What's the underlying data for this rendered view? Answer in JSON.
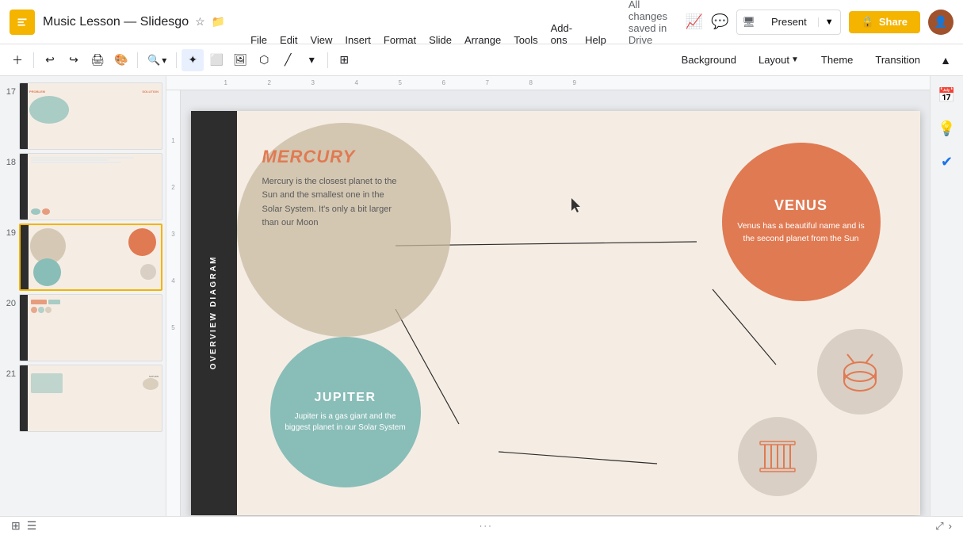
{
  "app": {
    "title": "Music Lesson — Slidesgo",
    "icon_color": "#f4b400"
  },
  "menu": {
    "file": "File",
    "edit": "Edit",
    "view": "View",
    "insert": "Insert",
    "format": "Format",
    "slide": "Slide",
    "arrange": "Arrange",
    "tools": "Tools",
    "addons": "Add-ons",
    "help": "Help",
    "autosave": "All changes saved in Drive"
  },
  "toolbar2": {
    "background": "Background",
    "layout": "Layout",
    "theme": "Theme",
    "transition": "Transition"
  },
  "slides": [
    {
      "num": "17",
      "active": false
    },
    {
      "num": "18",
      "active": false
    },
    {
      "num": "19",
      "active": true
    },
    {
      "num": "20",
      "active": false
    },
    {
      "num": "21",
      "active": false
    }
  ],
  "slide_content": {
    "sidebar_label": "OVERVIEW DIAGRAM",
    "mercury": {
      "title": "MERCURY",
      "body": "Mercury is the closest planet to the Sun and the smallest one in the Solar System. It's only a bit larger than our Moon"
    },
    "venus": {
      "title": "VENUS",
      "body": "Venus has a beautiful name and is the second planet from the Sun"
    },
    "jupiter": {
      "title": "JUPITER",
      "body": "Jupiter is a gas giant and the biggest planet in our Solar System"
    }
  },
  "present": {
    "label": "Present"
  },
  "share": {
    "label": "Share"
  },
  "bottom": {
    "dots": "···"
  }
}
